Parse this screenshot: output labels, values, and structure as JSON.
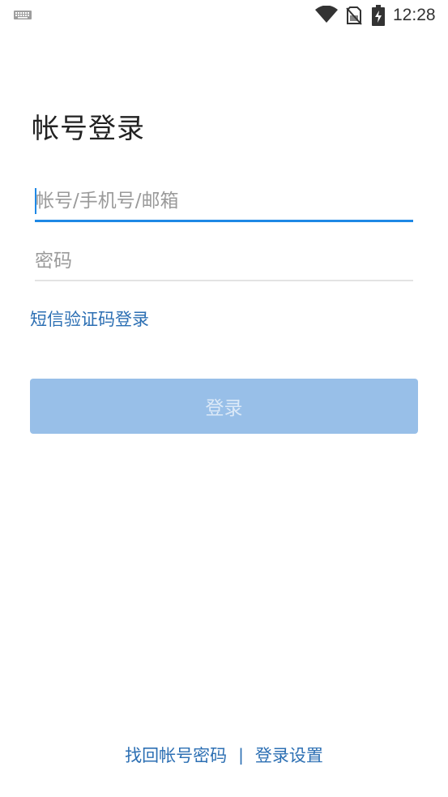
{
  "status_bar": {
    "time": "12:28",
    "icons": [
      "keyboard-icon",
      "wifi-icon",
      "no-sim-icon",
      "battery-charging-icon"
    ]
  },
  "page": {
    "title": "帐号登录"
  },
  "form": {
    "account_placeholder": "帐号/手机号/邮箱",
    "account_value": "",
    "password_placeholder": "密码",
    "password_value": ""
  },
  "sms_login_link": "短信验证码登录",
  "login_button": "登录",
  "footer": {
    "recover_link": "找回帐号密码",
    "divider": "|",
    "settings_link": "登录设置"
  },
  "colors": {
    "accent": "#1e88e5",
    "link": "#2c6fb3",
    "button_disabled_bg": "#98bfe8"
  }
}
